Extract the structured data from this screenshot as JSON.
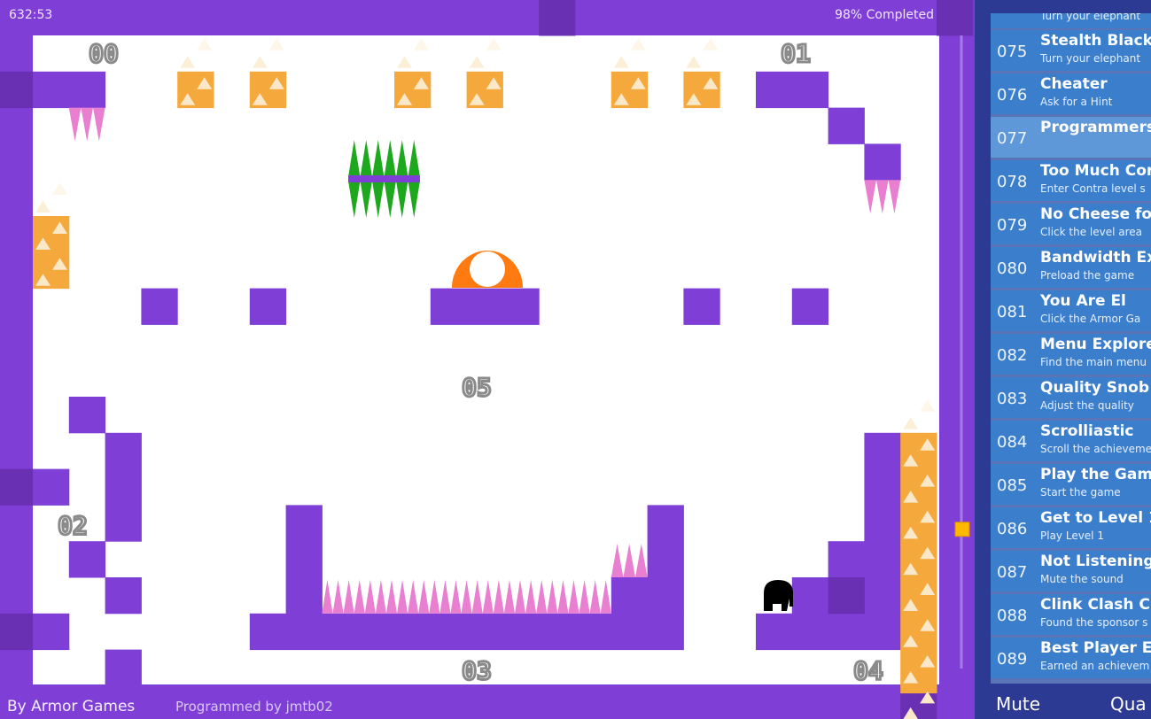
{
  "hud": {
    "timer": "632:53",
    "progress": "98% Completed",
    "byline": "By Armor Games",
    "programmer": "Programmed by jmtb02"
  },
  "level_labels": [
    "00",
    "01",
    "02",
    "03",
    "04",
    "05"
  ],
  "colors": {
    "wall": "#7f3fd6",
    "wall_dark": "#6a30b4",
    "floor": "#ffffff",
    "orange_block": "#f5a93c",
    "spike_pink": "#e87fd0",
    "spike_green": "#1ea81e",
    "dome": "#ff7a10",
    "panel": "#2d3a94",
    "achievement": "#3b7fcc"
  },
  "player": {
    "icon": "elephant-icon"
  },
  "scroll": {
    "position_percent": 78
  },
  "achievements": {
    "partial_top_desc": "Turn your elephant",
    "items": [
      {
        "num": "075",
        "title": "Stealth Black",
        "desc": "Turn your elephant"
      },
      {
        "num": "076",
        "title": "Cheater",
        "desc": "Ask for a Hint"
      },
      {
        "num": "077",
        "title": "Programmers",
        "desc": "",
        "highlighted": true
      },
      {
        "num": "078",
        "title": "Too Much Cor",
        "desc": "Enter Contra level s"
      },
      {
        "num": "079",
        "title": "No Cheese fo",
        "desc": "Click the level area"
      },
      {
        "num": "080",
        "title": "Bandwidth Ex",
        "desc": "Preload the game"
      },
      {
        "num": "081",
        "title": "You Are El",
        "desc": "Click the Armor Ga"
      },
      {
        "num": "082",
        "title": "Menu Explore",
        "desc": "Find the main menu"
      },
      {
        "num": "083",
        "title": "Quality Snob",
        "desc": "Adjust the quality"
      },
      {
        "num": "084",
        "title": "Scrolliastic",
        "desc": "Scroll the achieveme"
      },
      {
        "num": "085",
        "title": "Play the Gam",
        "desc": "Start the game"
      },
      {
        "num": "086",
        "title": "Get to Level 1",
        "desc": "Play Level 1"
      },
      {
        "num": "087",
        "title": "Not Listening",
        "desc": "Mute the sound"
      },
      {
        "num": "088",
        "title": "Clink Clash C",
        "desc": "Found the sponsor s"
      },
      {
        "num": "089",
        "title": "Best Player Ev",
        "desc": "Earned an achievem"
      }
    ]
  },
  "panel_buttons": {
    "mute": "Mute",
    "quality": "Qua"
  }
}
